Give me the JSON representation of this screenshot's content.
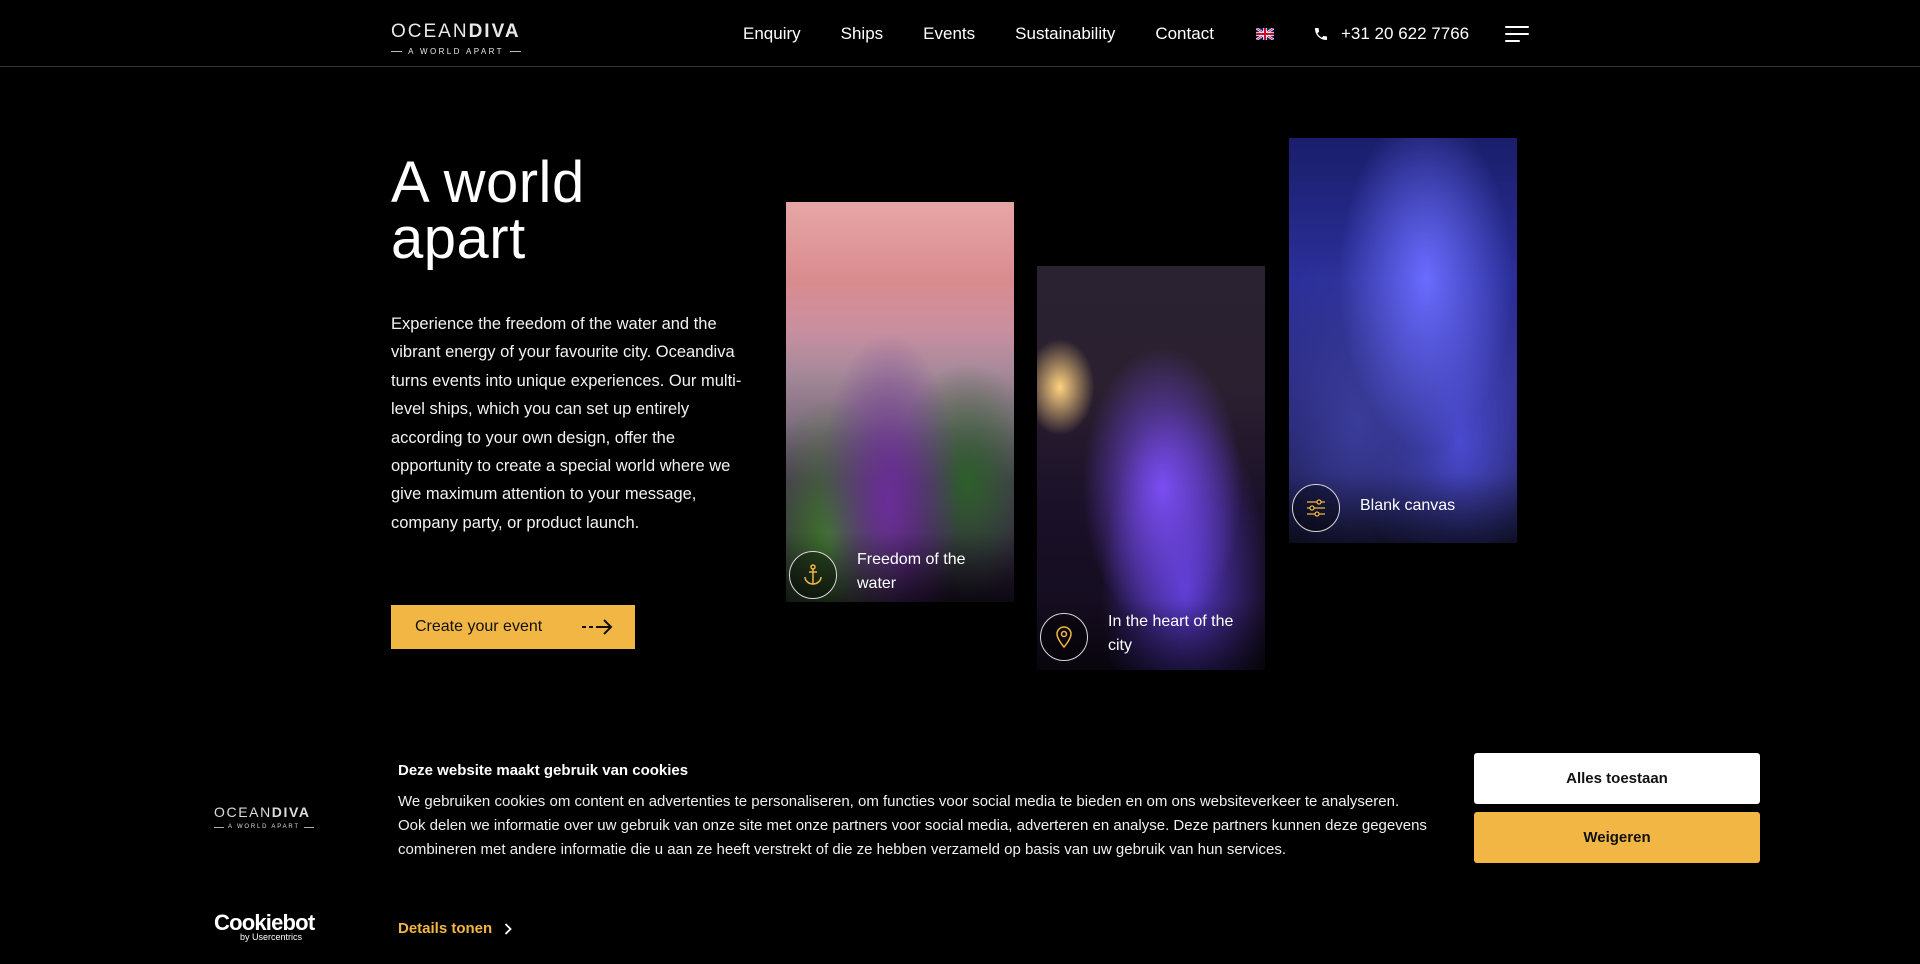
{
  "header": {
    "logo_main_a": "OCEAN",
    "logo_main_b": "DIVA",
    "logo_sub": "A WORLD APART",
    "nav": [
      "Enquiry",
      "Ships",
      "Events",
      "Sustainability",
      "Contact"
    ],
    "language_icon": "uk-flag-icon",
    "phone": "+31 20 622 7766"
  },
  "hero": {
    "title_line1": "A world",
    "title_line2": "apart",
    "text": "Experience the freedom of the water and the vibrant energy of your favourite city. Oceandiva turns events into unique experiences. Our multi-level ships, which you can set up entirely according to your own design, offer the opportunity to create a special world where we give maximum attention to your message, company party, or product launch.",
    "cta_label": "Create your event"
  },
  "cards": [
    {
      "caption": "Freedom of the water",
      "icon": "anchor-icon"
    },
    {
      "caption": "In the heart of the city",
      "icon": "location-pin-icon"
    },
    {
      "caption": "Blank canvas",
      "icon": "sliders-icon"
    }
  ],
  "cookie": {
    "title": "Deze website maakt gebruik van cookies",
    "body": "We gebruiken cookies om content en advertenties te personaliseren, om functies voor social media te bieden en om ons websiteverkeer te analyseren. Ook delen we informatie over uw gebruik van onze site met onze partners voor social media, adverteren en analyse. Deze partners kunnen deze gegevens combineren met andere informatie die u aan ze heeft verstrekt of die ze hebben verzameld op basis van uw gebruik van hun services.",
    "details_label": "Details tonen",
    "allow_label": "Alles toestaan",
    "deny_label": "Weigeren",
    "brand_name": "Cookiebot",
    "brand_by": "by Usercentrics",
    "logo_main_a": "OCEAN",
    "logo_main_b": "DIVA",
    "logo_sub": "A WORLD APART"
  },
  "colors": {
    "accent": "#f2b644",
    "background": "#000000",
    "text": "#ffffff"
  }
}
